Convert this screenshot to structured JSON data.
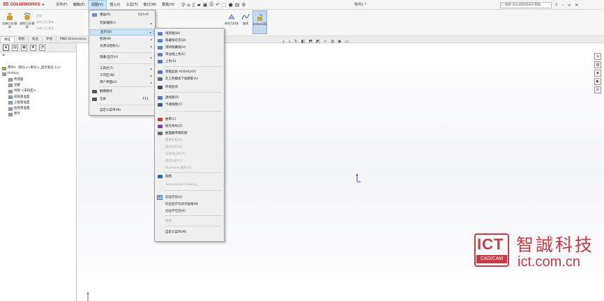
{
  "app": {
    "logo_mark": "3S",
    "logo_text": "SOLIDWORKS",
    "document_title": "零件1 *",
    "search_placeholder": "搜索 SOLIDWORKS 帮助"
  },
  "menubar": {
    "items": [
      "文件(F)",
      "编辑(E)",
      "视图(V)",
      "插入(I)",
      "工具(T)",
      "窗口(W)",
      "帮助(H)"
    ],
    "active_index": 2
  },
  "ribbon": {
    "buttons": [
      {
        "label": "拉伸凸台/基体"
      },
      {
        "label": "旋转凸台/基体"
      },
      {
        "label": "参考几何体"
      },
      {
        "label": "曲线"
      },
      {
        "label": "Instant3D"
      }
    ],
    "small_items": [
      "扫描",
      "放样凸台/基体",
      "边界凸台/基体"
    ]
  },
  "cm_tabs": [
    "特征",
    "草图",
    "标注",
    "评估",
    "MBD Dimensions"
  ],
  "left_panel": {
    "tabs": [
      "◈",
      "▤",
      "▦",
      "✥",
      "◔"
    ],
    "tree": [
      {
        "label": "零件1（默认<<默认>_显示状态 1>）",
        "color": "#c9a23a"
      },
      {
        "label": "History",
        "color": "#8aa3c8"
      },
      {
        "label": "传感器",
        "color": "#8aa3c8"
      },
      {
        "label": "注解",
        "color": "#8aa3c8"
      },
      {
        "label": "材质 <未指定>",
        "color": "#8aa3c8"
      },
      {
        "label": "前视基准面",
        "color": "#8aa3c8"
      },
      {
        "label": "上视基准面",
        "color": "#8aa3c8"
      },
      {
        "label": "右视基准面",
        "color": "#8aa3c8"
      },
      {
        "label": "原点",
        "color": "#8aa3c8"
      }
    ]
  },
  "view_menu": {
    "items": [
      {
        "label": "重画(R)",
        "shortcut": "Ctrl+R",
        "icon_color": "#6a8fc2"
      },
      {
        "label": "荧屏捕获(I)",
        "arrow": true
      },
      {
        "label": "显示(D)",
        "arrow": true,
        "highlight": true
      },
      {
        "label": "修改(M)",
        "arrow": true
      },
      {
        "label": "光源与相机(L)",
        "arrow": true
      },
      {
        "label": "隐藏/显示(H)",
        "arrow": true
      },
      {
        "label": "工具栏(T)",
        "arrow": true
      },
      {
        "label": "工作区(W)",
        "arrow": true
      },
      {
        "label": "用户界面(U)",
        "arrow": true
      },
      {
        "label": "触摸模式",
        "icon_color": "#555555"
      },
      {
        "label": "全屏",
        "shortcut": "F11",
        "icon_color": "#555555"
      },
      {
        "label": "自定义菜单(M)"
      }
    ]
  },
  "display_submenu": {
    "items": [
      {
        "label": "线架图(W)",
        "icon_color": "#5d83b8"
      },
      {
        "label": "隐藏线可见(D)",
        "icon_color": "#5d83b8"
      },
      {
        "label": "消除隐藏线(H)",
        "icon_color": "#5d83b8"
      },
      {
        "label": "带边线上色(E)",
        "icon_color": "#5d83b8"
      },
      {
        "label": "上色(S)",
        "icon_color": "#4a78b5"
      },
      {
        "label": "草稿品质 HLR/HLV(F)",
        "icon_color": "#4a78b5"
      },
      {
        "label": "在上色模式下加阴影(A)",
        "icon_color": "#5a6a7a"
      },
      {
        "label": "环境封闭",
        "icon_color": "#3d4a5a"
      },
      {
        "label": "透视图(P)",
        "icon_color": "#4a78b5"
      },
      {
        "label": "卡通视图(C)",
        "icon_color": "#3a5a8a"
      },
      {
        "label": "曲率(C)",
        "icon_color": "#c04040"
      },
      {
        "label": "斑马条纹(Z)",
        "icon_color": "#8040a0"
      },
      {
        "label": "曲面曲率梳形图",
        "icon_color": "#6a6a6a"
      },
      {
        "label": "拔模分析(A)",
        "disabled": true
      },
      {
        "label": "底切分析(U)",
        "disabled": true
      },
      {
        "label": "分型线分析(P)",
        "disabled": true
      },
      {
        "label": "厚度分析(T)",
        "disabled": true
      },
      {
        "label": "RealView 图形(V)",
        "disabled": true
      },
      {
        "label": "贴图",
        "icon_color": "#2a6a9a"
      },
      {
        "label": "Tessellation Viewing",
        "disabled": true
      },
      {
        "label": "切边可见(V)",
        "checked": true
      },
      {
        "label": "切边显示为双点画线(N)"
      },
      {
        "label": "切边不可见(R)"
      },
      {
        "label": "图层",
        "disabled": true
      },
      {
        "label": "自定义菜单(M)"
      }
    ]
  },
  "task_pane": [
    "⌂",
    "▤",
    "◈",
    "◐",
    "☷"
  ],
  "watermark": {
    "logo": "ICT",
    "sub": "CAD/CAM",
    "cn": "智誠科技",
    "url": "ict.com.cn"
  }
}
